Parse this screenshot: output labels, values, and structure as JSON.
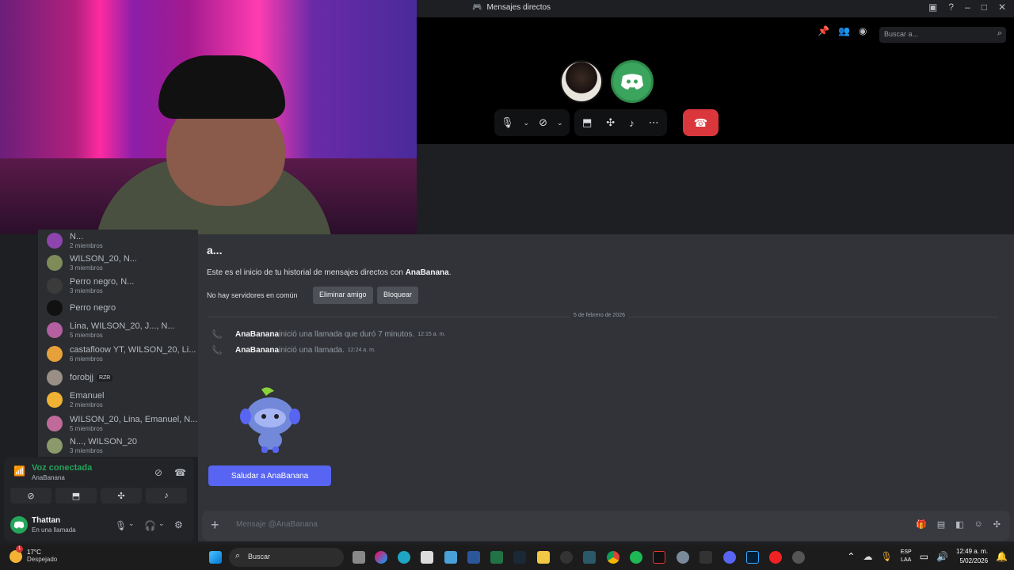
{
  "window": {
    "title": "Mensajes directos",
    "search_placeholder": "Buscar a..."
  },
  "dm_list": [
    {
      "name": "N...",
      "sub": "2 miembros",
      "color": "#8e44ad"
    },
    {
      "name": "WILSON_20, N...",
      "sub": "3 miembros",
      "color": "#7f8c5a"
    },
    {
      "name": "Perro negro, N...",
      "sub": "3 miembros",
      "color": "#3b3b3b"
    },
    {
      "name": "Perro negro",
      "sub": "",
      "color": "#111111"
    },
    {
      "name": "Lina, WILSON_20, J..., N...",
      "sub": "5 miembros",
      "color": "#b35fa0"
    },
    {
      "name": "castafloow YT, WILSON_20, Li...",
      "sub": "6 miembros",
      "color": "#e6a13a"
    },
    {
      "name": "forobjj",
      "sub": "",
      "color": "#9a8f86",
      "badge": "RZR"
    },
    {
      "name": "Emanuel",
      "sub": "2 miembros",
      "color": "#f0b232"
    },
    {
      "name": "WILSON_20, Lina, Emanuel, N...",
      "sub": "5 miembros",
      "color": "#c06a9a"
    },
    {
      "name": "N..., WILSON_20",
      "sub": "3 miembros",
      "color": "#8b9a6a"
    }
  ],
  "voice": {
    "status": "Voz conectada",
    "channel": "AnaBanana"
  },
  "user": {
    "name": "Thattan",
    "status": "En una llamada"
  },
  "chat": {
    "heading": "a...",
    "intro_prefix": "Este es el inicio de tu historial de mensajes directos con ",
    "intro_user": "AnaBanana",
    "intro_suffix": ".",
    "no_servers": "No hay servidores en común",
    "remove_friend": "Eliminar amigo",
    "block": "Bloquear",
    "date_divider": "5 de febrero de 2026",
    "logs": [
      {
        "user": "AnaBanana",
        "text": " inició una llamada que duró 7 minutos.",
        "time": "12:15 a. m."
      },
      {
        "user": "AnaBanana",
        "text": " inició una llamada.",
        "time": "12:24 a. m."
      }
    ],
    "wave_button": "Saludar a AnaBanana",
    "composer_placeholder": "Mensaje @AnaBanana"
  },
  "taskbar": {
    "temp": "17°C",
    "weather": "Despejado",
    "search": "Buscar",
    "lang1": "ESP",
    "lang2": "LAA",
    "time": "12:49 a. m.",
    "date": "5/02/2026"
  }
}
